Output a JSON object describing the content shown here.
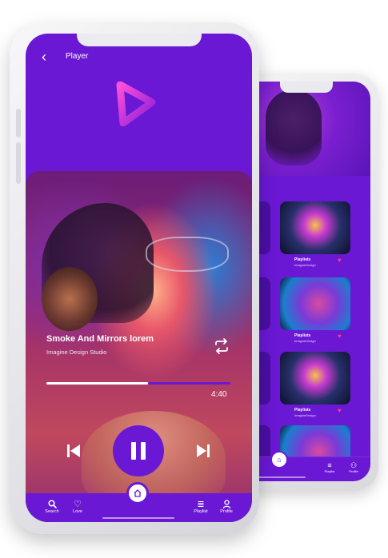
{
  "player": {
    "header_title": "Player",
    "song_title": "Smoke And Mirrors lorem",
    "artist": "Imagine Design Studio",
    "time_total": "4:40",
    "progress": 0.55
  },
  "nav": {
    "items": [
      {
        "label": "Search",
        "icon": "search-icon"
      },
      {
        "label": "Love",
        "icon": "heart-icon"
      },
      {
        "label": "Playlist",
        "icon": "playlist-icon"
      },
      {
        "label": "Profile",
        "icon": "profile-icon"
      }
    ]
  },
  "back_screen": {
    "cards": [
      {
        "title": "Playlists",
        "subtitle": "ImagineDesign"
      },
      {
        "title": "Playlists",
        "subtitle": "ImagineDesign"
      },
      {
        "title": "Playlists",
        "subtitle": "ImagineDesign"
      }
    ],
    "nav": [
      {
        "label": "Playlist",
        "icon": "playlist-icon"
      },
      {
        "label": "Profile",
        "icon": "profile-icon"
      }
    ]
  },
  "colors": {
    "accent": "#6a18d4",
    "heart": "#ff3b8d",
    "logo_gradient": [
      "#e23ad0",
      "#6a18d4"
    ]
  }
}
